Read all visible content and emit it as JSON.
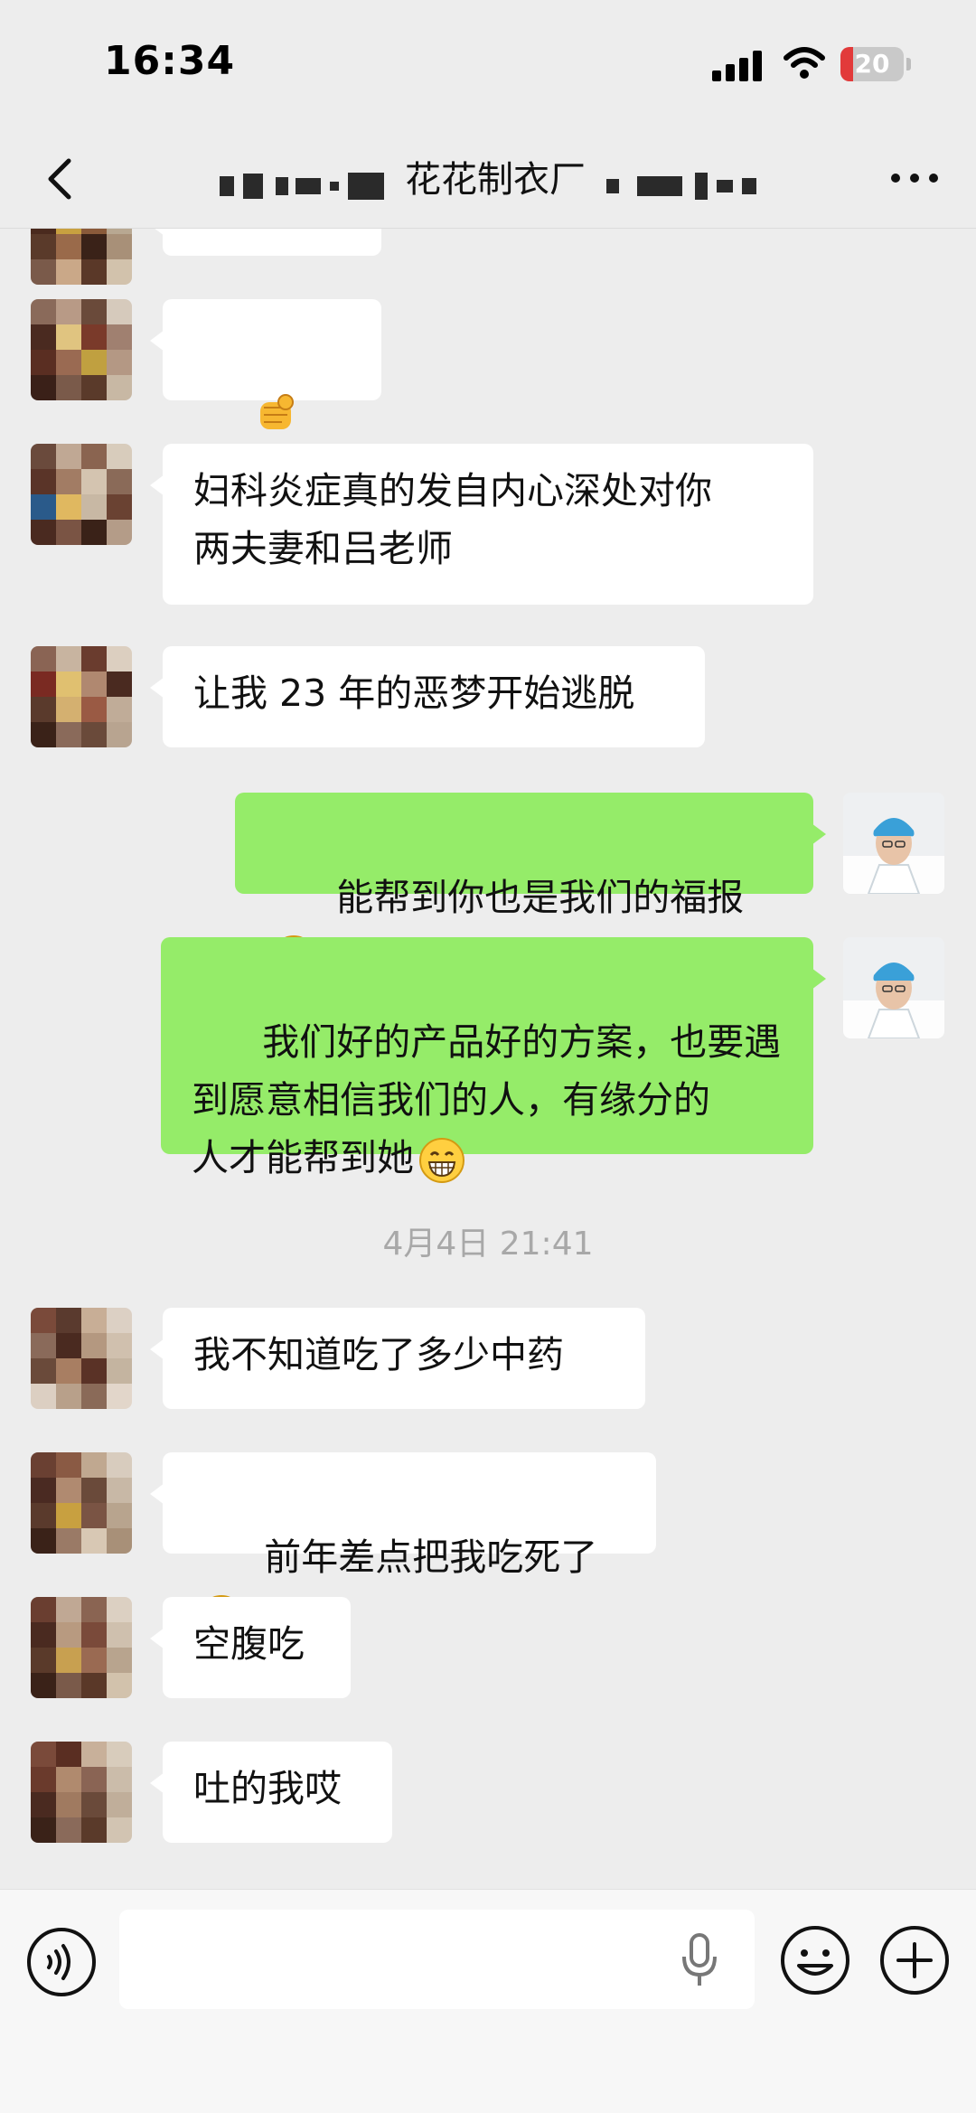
{
  "status_bar": {
    "time": "16:34",
    "battery": "20"
  },
  "nav": {
    "title": "花花制衣厂"
  },
  "messages": [
    {
      "side": "in",
      "text": "妇科炎症真的发自内心深处对你\n两夫妻和吕老师"
    },
    {
      "side": "in",
      "text": "让我 23 年的恶梦开始逃脱"
    },
    {
      "side": "out",
      "text": "能帮到你也是我们的福报"
    },
    {
      "side": "out",
      "text": "我们好的产品好的方案，也要遇\n到愿意相信我们的人，有缘分的\n人才能帮到她"
    },
    {
      "side": "in",
      "text": "我不知道吃了多少中药"
    },
    {
      "side": "in",
      "text": "前年差点把我吃死了"
    },
    {
      "side": "in",
      "text": "空腹吃"
    },
    {
      "side": "in",
      "text": "吐的我哎"
    }
  ],
  "timestamp": "4月4日 21:41",
  "icons": {
    "back": "chevron-left-icon",
    "more": "more-icon",
    "voice": "voice-icon",
    "mic": "mic-icon",
    "emoji": "emoji-icon",
    "plus": "plus-icon"
  },
  "colors": {
    "outgoing_bubble": "#95ec69",
    "incoming_bubble": "#ffffff",
    "background": "#ededed"
  }
}
